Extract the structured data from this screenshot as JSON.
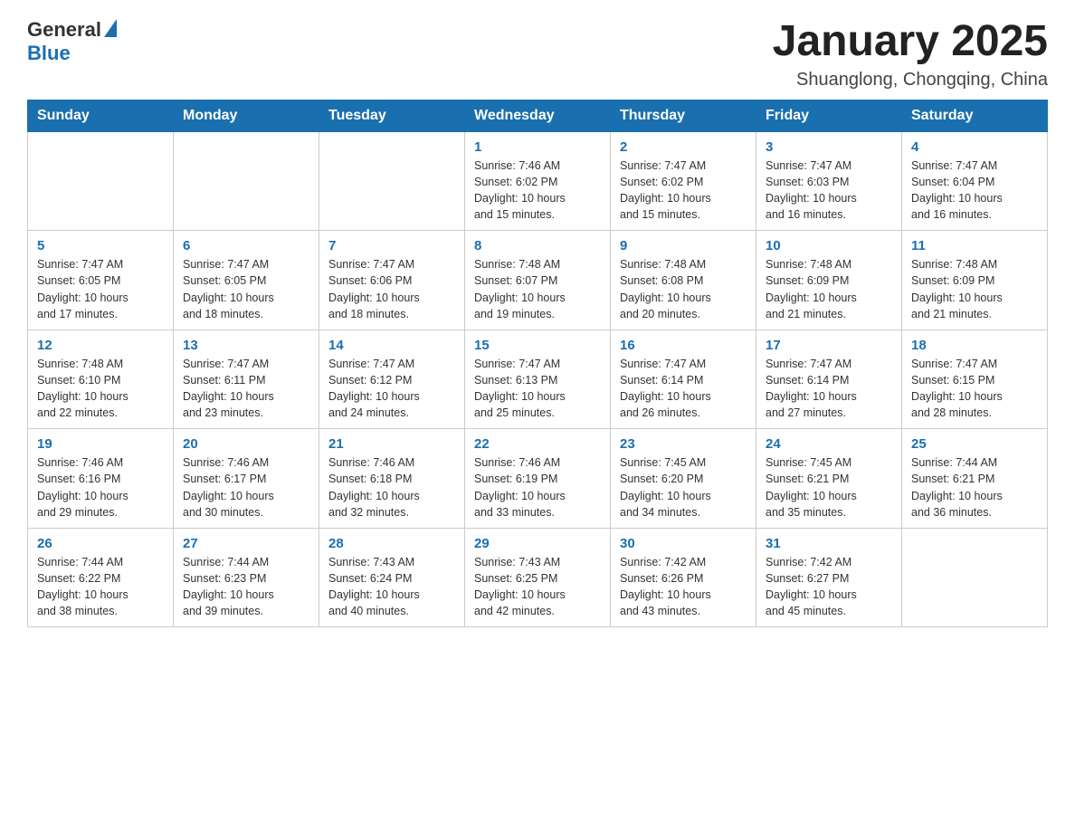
{
  "header": {
    "logo": {
      "general": "General",
      "blue": "Blue"
    },
    "title": "January 2025",
    "subtitle": "Shuanglong, Chongqing, China"
  },
  "weekdays": [
    "Sunday",
    "Monday",
    "Tuesday",
    "Wednesday",
    "Thursday",
    "Friday",
    "Saturday"
  ],
  "weeks": [
    [
      {
        "day": "",
        "info": ""
      },
      {
        "day": "",
        "info": ""
      },
      {
        "day": "",
        "info": ""
      },
      {
        "day": "1",
        "info": "Sunrise: 7:46 AM\nSunset: 6:02 PM\nDaylight: 10 hours\nand 15 minutes."
      },
      {
        "day": "2",
        "info": "Sunrise: 7:47 AM\nSunset: 6:02 PM\nDaylight: 10 hours\nand 15 minutes."
      },
      {
        "day": "3",
        "info": "Sunrise: 7:47 AM\nSunset: 6:03 PM\nDaylight: 10 hours\nand 16 minutes."
      },
      {
        "day": "4",
        "info": "Sunrise: 7:47 AM\nSunset: 6:04 PM\nDaylight: 10 hours\nand 16 minutes."
      }
    ],
    [
      {
        "day": "5",
        "info": "Sunrise: 7:47 AM\nSunset: 6:05 PM\nDaylight: 10 hours\nand 17 minutes."
      },
      {
        "day": "6",
        "info": "Sunrise: 7:47 AM\nSunset: 6:05 PM\nDaylight: 10 hours\nand 18 minutes."
      },
      {
        "day": "7",
        "info": "Sunrise: 7:47 AM\nSunset: 6:06 PM\nDaylight: 10 hours\nand 18 minutes."
      },
      {
        "day": "8",
        "info": "Sunrise: 7:48 AM\nSunset: 6:07 PM\nDaylight: 10 hours\nand 19 minutes."
      },
      {
        "day": "9",
        "info": "Sunrise: 7:48 AM\nSunset: 6:08 PM\nDaylight: 10 hours\nand 20 minutes."
      },
      {
        "day": "10",
        "info": "Sunrise: 7:48 AM\nSunset: 6:09 PM\nDaylight: 10 hours\nand 21 minutes."
      },
      {
        "day": "11",
        "info": "Sunrise: 7:48 AM\nSunset: 6:09 PM\nDaylight: 10 hours\nand 21 minutes."
      }
    ],
    [
      {
        "day": "12",
        "info": "Sunrise: 7:48 AM\nSunset: 6:10 PM\nDaylight: 10 hours\nand 22 minutes."
      },
      {
        "day": "13",
        "info": "Sunrise: 7:47 AM\nSunset: 6:11 PM\nDaylight: 10 hours\nand 23 minutes."
      },
      {
        "day": "14",
        "info": "Sunrise: 7:47 AM\nSunset: 6:12 PM\nDaylight: 10 hours\nand 24 minutes."
      },
      {
        "day": "15",
        "info": "Sunrise: 7:47 AM\nSunset: 6:13 PM\nDaylight: 10 hours\nand 25 minutes."
      },
      {
        "day": "16",
        "info": "Sunrise: 7:47 AM\nSunset: 6:14 PM\nDaylight: 10 hours\nand 26 minutes."
      },
      {
        "day": "17",
        "info": "Sunrise: 7:47 AM\nSunset: 6:14 PM\nDaylight: 10 hours\nand 27 minutes."
      },
      {
        "day": "18",
        "info": "Sunrise: 7:47 AM\nSunset: 6:15 PM\nDaylight: 10 hours\nand 28 minutes."
      }
    ],
    [
      {
        "day": "19",
        "info": "Sunrise: 7:46 AM\nSunset: 6:16 PM\nDaylight: 10 hours\nand 29 minutes."
      },
      {
        "day": "20",
        "info": "Sunrise: 7:46 AM\nSunset: 6:17 PM\nDaylight: 10 hours\nand 30 minutes."
      },
      {
        "day": "21",
        "info": "Sunrise: 7:46 AM\nSunset: 6:18 PM\nDaylight: 10 hours\nand 32 minutes."
      },
      {
        "day": "22",
        "info": "Sunrise: 7:46 AM\nSunset: 6:19 PM\nDaylight: 10 hours\nand 33 minutes."
      },
      {
        "day": "23",
        "info": "Sunrise: 7:45 AM\nSunset: 6:20 PM\nDaylight: 10 hours\nand 34 minutes."
      },
      {
        "day": "24",
        "info": "Sunrise: 7:45 AM\nSunset: 6:21 PM\nDaylight: 10 hours\nand 35 minutes."
      },
      {
        "day": "25",
        "info": "Sunrise: 7:44 AM\nSunset: 6:21 PM\nDaylight: 10 hours\nand 36 minutes."
      }
    ],
    [
      {
        "day": "26",
        "info": "Sunrise: 7:44 AM\nSunset: 6:22 PM\nDaylight: 10 hours\nand 38 minutes."
      },
      {
        "day": "27",
        "info": "Sunrise: 7:44 AM\nSunset: 6:23 PM\nDaylight: 10 hours\nand 39 minutes."
      },
      {
        "day": "28",
        "info": "Sunrise: 7:43 AM\nSunset: 6:24 PM\nDaylight: 10 hours\nand 40 minutes."
      },
      {
        "day": "29",
        "info": "Sunrise: 7:43 AM\nSunset: 6:25 PM\nDaylight: 10 hours\nand 42 minutes."
      },
      {
        "day": "30",
        "info": "Sunrise: 7:42 AM\nSunset: 6:26 PM\nDaylight: 10 hours\nand 43 minutes."
      },
      {
        "day": "31",
        "info": "Sunrise: 7:42 AM\nSunset: 6:27 PM\nDaylight: 10 hours\nand 45 minutes."
      },
      {
        "day": "",
        "info": ""
      }
    ]
  ]
}
